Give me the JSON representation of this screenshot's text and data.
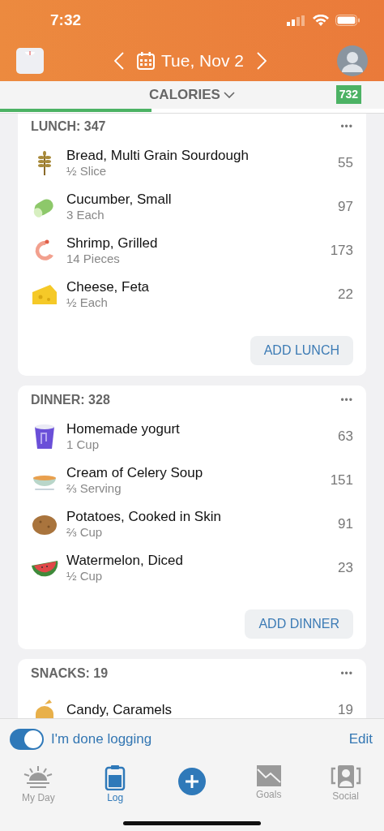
{
  "status_bar": {
    "time": "7:32"
  },
  "header": {
    "date": "Tue, Nov 2"
  },
  "summary": {
    "label": "CALORIES",
    "badge": "732",
    "level": 0.395
  },
  "meals": [
    {
      "title": "LUNCH: 347",
      "more": "•••",
      "button": "ADD LUNCH",
      "foods": [
        {
          "kind": "grain",
          "name": "Bread, Multi Grain Sourdough",
          "portion": "½ Slice",
          "calories": "55"
        },
        {
          "kind": "cucumber",
          "name": "Cucumber, Small",
          "portion": "3 Each",
          "calories": "97"
        },
        {
          "kind": "shrimp",
          "name": "Shrimp, Grilled",
          "portion": "14 Pieces",
          "calories": "173"
        },
        {
          "kind": "cheese",
          "name": "Cheese, Feta",
          "portion": "½ Each",
          "calories": "22"
        }
      ]
    },
    {
      "title": "DINNER: 328",
      "more": "•••",
      "button": "ADD DINNER",
      "foods": [
        {
          "kind": "cup",
          "name": "Homemade yogurt",
          "portion": "1 Cup",
          "calories": "63"
        },
        {
          "kind": "bowl",
          "name": "Cream of Celery Soup",
          "portion": "⅔ Serving",
          "calories": "151"
        },
        {
          "kind": "potato",
          "name": "Potatoes, Cooked in Skin",
          "portion": "⅔ Cup",
          "calories": "91"
        },
        {
          "kind": "melon",
          "name": "Watermelon, Diced",
          "portion": "½ Cup",
          "calories": "23"
        }
      ]
    },
    {
      "title": "SNACKS: 19",
      "more": "•••",
      "foods": [
        {
          "kind": "candy",
          "name": "Candy, Caramels",
          "calories": "19"
        }
      ]
    }
  ],
  "done_logging": {
    "label": "I'm done logging",
    "on": true,
    "edit": "Edit"
  },
  "tabs": [
    {
      "label": "My Day",
      "selected": false,
      "kind": "sun"
    },
    {
      "label": "Log",
      "selected": true,
      "kind": "log"
    },
    {
      "kind": "add",
      "selected": false
    },
    {
      "label": "Goals",
      "selected": false,
      "kind": "goals"
    },
    {
      "label": "Social",
      "selected": false,
      "kind": "social"
    }
  ]
}
